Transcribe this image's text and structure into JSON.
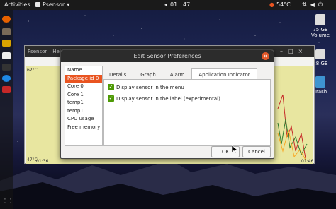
{
  "topbar": {
    "activities": "Activities",
    "app_name": "Psensor",
    "clock": "01 : 47",
    "temperature": "54°C"
  },
  "desktop": {
    "volume_label": "75 GB\nVolume",
    "volume_label_l1": "75 GB",
    "volume_label_l2": "Volume",
    "disk2_label": "28 GB",
    "trash_label": "Trash"
  },
  "psensor": {
    "menu_title": "Psensor",
    "menu_help": "Help",
    "y_max": "62°C",
    "y_min": "47°C",
    "x_start": "01:36",
    "x_end": "01:46"
  },
  "dialog": {
    "title": "Edit Sensor Preferences",
    "sensors": [
      {
        "name": "Name",
        "selected": false
      },
      {
        "name": "Package id 0",
        "selected": true
      },
      {
        "name": "Core 0",
        "selected": false
      },
      {
        "name": "Core 1",
        "selected": false
      },
      {
        "name": "temp1",
        "selected": false
      },
      {
        "name": "temp1",
        "selected": false
      },
      {
        "name": "CPU usage",
        "selected": false
      },
      {
        "name": "Free memory",
        "selected": false
      }
    ],
    "tabs": [
      "Details",
      "Graph",
      "Alarm",
      "Application Indicator"
    ],
    "active_tab": "Application Indicator",
    "options": [
      {
        "label": "Display sensor in the menu",
        "checked": true
      },
      {
        "label": "Display sensor in the label (experimental)",
        "checked": true
      }
    ],
    "ok_label": "OK",
    "cancel_label": "Cancel"
  },
  "colors": {
    "accent": "#e95420",
    "checkbox": "#4e9a06",
    "graph_bg": "#e8e6a0"
  }
}
